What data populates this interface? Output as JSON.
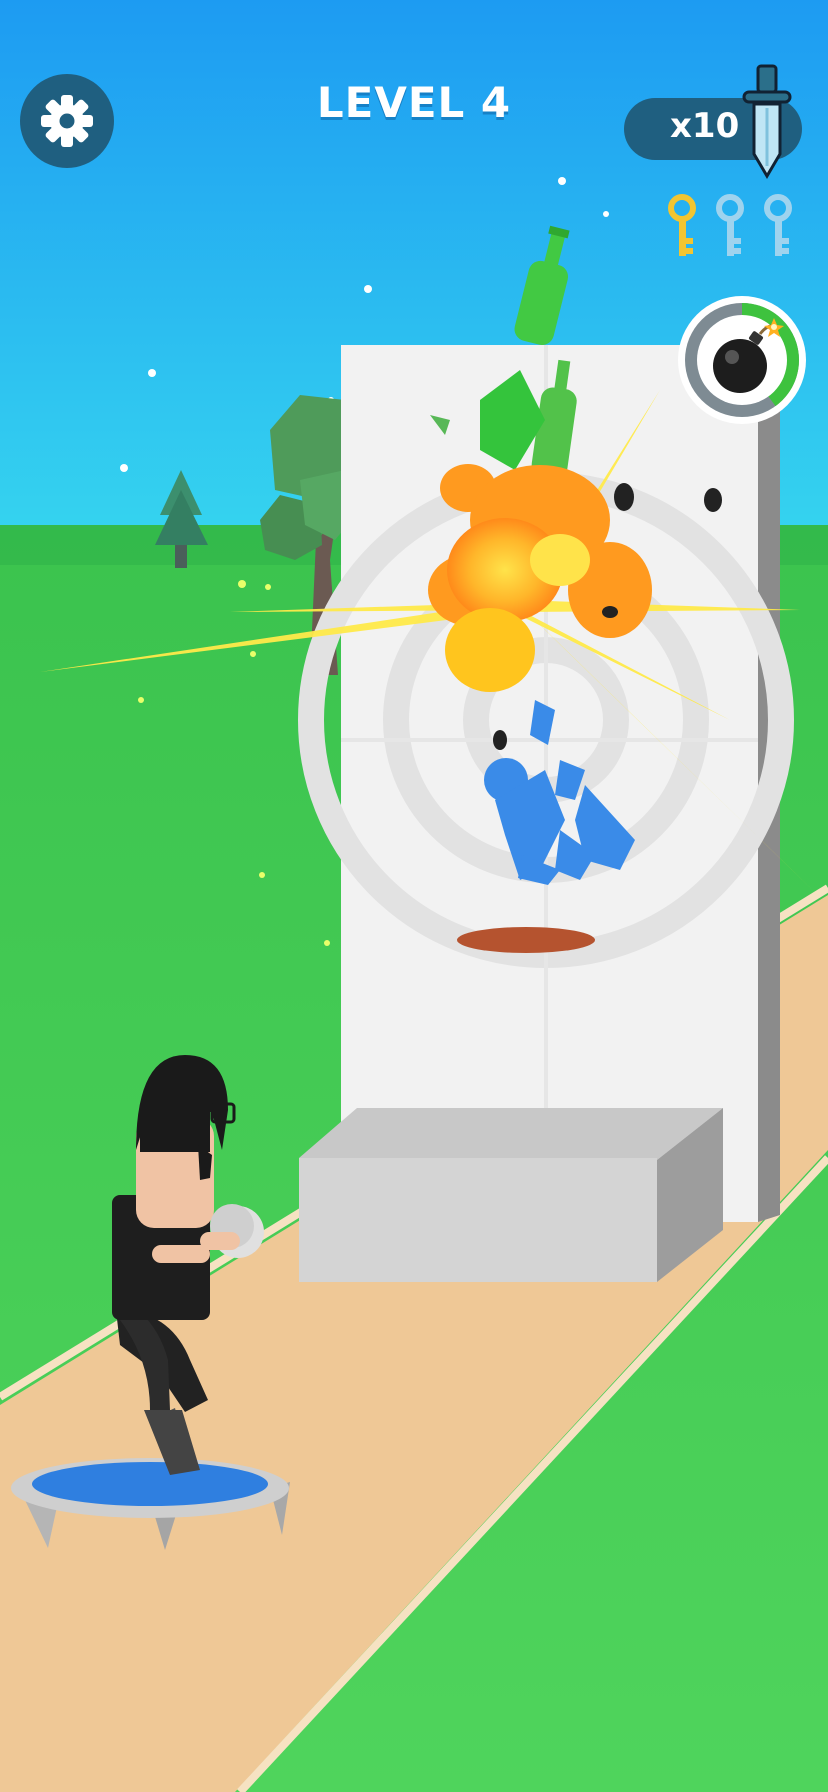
{
  "hud": {
    "level_label": "LEVEL 4",
    "ammo_count": "x10",
    "ammo_icon": "dagger-icon",
    "settings_icon": "gear-icon",
    "keys": {
      "collected": 1,
      "total": 3,
      "collected_color": "#f2c531",
      "empty_color": "#9fd3ee"
    },
    "bomb": {
      "icon": "bomb-icon",
      "charge_fraction": 0.4,
      "charge_color": "#3ec23e"
    }
  },
  "colors": {
    "sky_top": "#1d9bf2",
    "sky_bottom": "#35d3ef",
    "grass": "#46c853",
    "path": "#efc896",
    "hud_panel": "#1f5f80"
  }
}
